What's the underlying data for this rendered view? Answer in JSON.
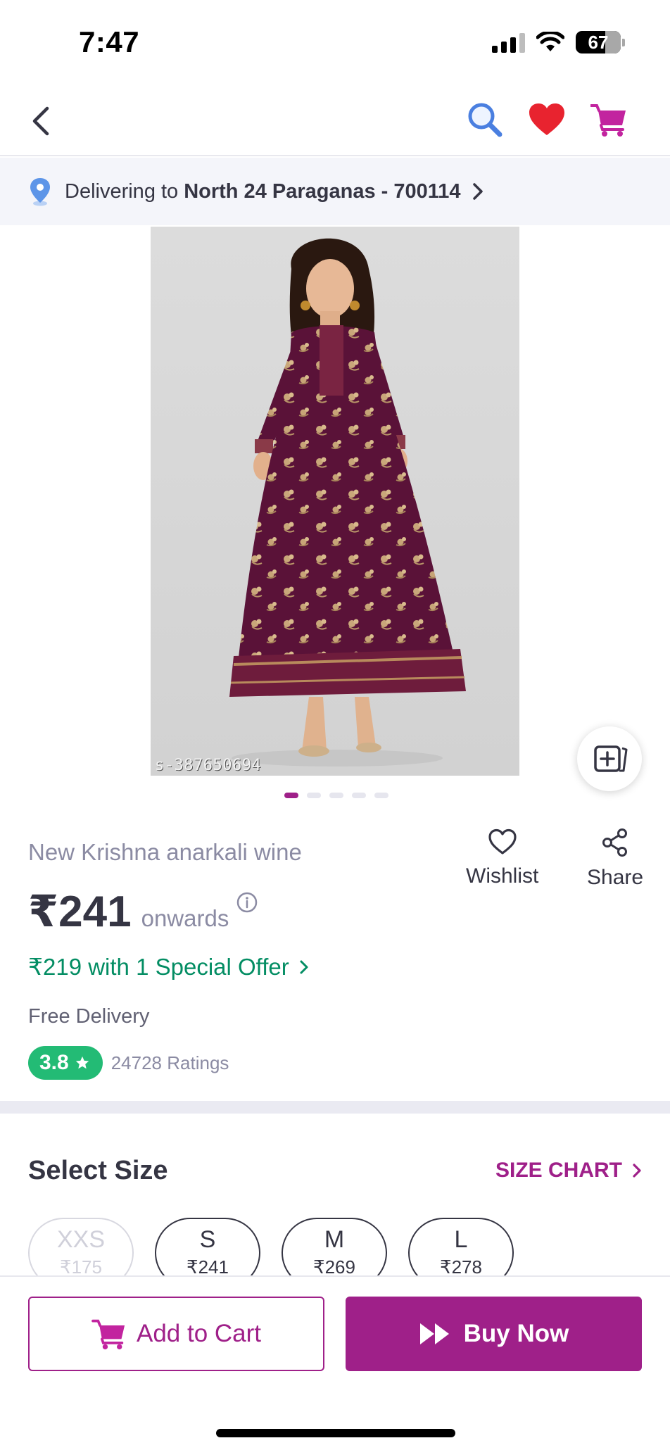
{
  "status_bar": {
    "time": "7:47",
    "battery": "67"
  },
  "delivery": {
    "prefix": "Delivering to",
    "location": "North 24 Paraganas - 700114"
  },
  "product": {
    "watermark": "s-387650694",
    "title": "New Krishna anarkali wine",
    "price": "₹241",
    "price_suffix": "onwards",
    "offer": "₹219 with 1 Special Offer",
    "delivery_note": "Free Delivery",
    "rating": "3.8",
    "ratings_count": "24728 Ratings",
    "image_count": 5,
    "active_image": 1
  },
  "actions": {
    "wishlist": "Wishlist",
    "share": "Share"
  },
  "size": {
    "title": "Select Size",
    "chart_link": "SIZE CHART",
    "options": [
      {
        "size": "XXS",
        "price": "₹175",
        "available": false
      },
      {
        "size": "S",
        "price": "₹241",
        "available": true
      },
      {
        "size": "M",
        "price": "₹269",
        "available": true
      },
      {
        "size": "L",
        "price": "₹278",
        "available": true
      }
    ]
  },
  "bottom_bar": {
    "add_to_cart": "Add to Cart",
    "buy_now": "Buy Now"
  },
  "colors": {
    "accent": "#9f2089",
    "offer_green": "#038d63",
    "rating_green": "#23bb75",
    "text_dark": "#353543",
    "text_muted": "#8b8ba3"
  }
}
